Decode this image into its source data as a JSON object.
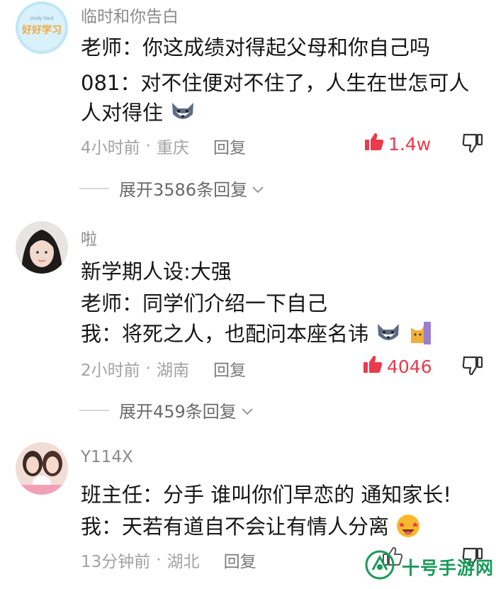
{
  "colors": {
    "like_accent": "#ea3a4c",
    "meta_gray": "#a2a2a2",
    "watermark_green": "#1a9a5a"
  },
  "comments": [
    {
      "username": "临时和你告白",
      "avatar_text": "好好学习",
      "lines": [
        "老师：你这成绩对得起父母和你自己吗",
        "081：对不住便对不住了，人生在世怎可人",
        "人对得住"
      ],
      "time": "4小时前",
      "location": "重庆",
      "reply_label": "回复",
      "likes": "1.4w",
      "expand": "展开3586条回复"
    },
    {
      "username": "啦",
      "lines": [
        "新学期人设:大强",
        "老师：同学们介绍一下自己",
        "我：将死之人，也配问本座名讳"
      ],
      "time": "2小时前",
      "location": "湖南",
      "reply_label": "回复",
      "likes": "4046",
      "expand": "展开459条回复"
    },
    {
      "username": "Y114X",
      "lines": [
        "班主任：分手 谁叫你们早恋的 通知家长!",
        "我：天若有道自不会让有情人分离"
      ],
      "time": "13分钟前",
      "location": "湖北",
      "reply_label": "回复"
    }
  ],
  "watermark": "十号手游网",
  "icons": [
    "thumbs-up-icon",
    "thumbs-down-icon",
    "chevron-down-icon",
    "husky-emoji",
    "cat-emoji",
    "star-eyes-emoji"
  ]
}
